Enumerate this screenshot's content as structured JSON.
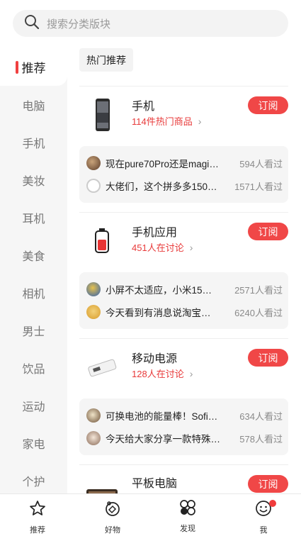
{
  "search": {
    "placeholder": "搜索分类版块"
  },
  "sidebar": {
    "items": [
      "推荐",
      "电脑",
      "手机",
      "美妆",
      "耳机",
      "美食",
      "相机",
      "男士",
      "饮品",
      "运动",
      "家电",
      "个护"
    ]
  },
  "main": {
    "hot_tag": "热门推荐",
    "sections": [
      {
        "title": "手机",
        "subtitle": "114件热门商品",
        "subscribe": "订阅",
        "thumb_icon": "phone-thumbnail",
        "posts": [
          {
            "text": "现在pure70Pro还是magic…",
            "views": "594人看过"
          },
          {
            "text": "大佬们，这个拼多多150…",
            "views": "1571人看过"
          }
        ]
      },
      {
        "title": "手机应用",
        "subtitle": "451人在讨论",
        "subscribe": "订阅",
        "thumb_icon": "battery-app-thumbnail",
        "posts": [
          {
            "text": "小屏不太适应，小米15…",
            "views": "2571人看过"
          },
          {
            "text": "今天看到有消息说淘宝…",
            "views": "6240人看过"
          }
        ]
      },
      {
        "title": "移动电源",
        "subtitle": "128人在讨论",
        "subscribe": "订阅",
        "thumb_icon": "power-bank-thumbnail",
        "posts": [
          {
            "text": "可换电池的能量棒！Sofir…",
            "views": "634人看过"
          },
          {
            "text": "今天给大家分享一款特殊…",
            "views": "578人看过"
          }
        ]
      },
      {
        "title": "平板电脑",
        "subscribe": "订阅",
        "thumb_icon": "tablet-thumbnail"
      }
    ]
  },
  "tabbar": {
    "items": [
      {
        "label": "推荐",
        "icon": "star-icon"
      },
      {
        "label": "好物",
        "icon": "tag-icon"
      },
      {
        "label": "发现",
        "icon": "clover-icon"
      },
      {
        "label": "我",
        "icon": "smile-icon"
      }
    ]
  },
  "colors": {
    "accent": "#f04747",
    "sidebar_bg": "#f6f6f6"
  }
}
